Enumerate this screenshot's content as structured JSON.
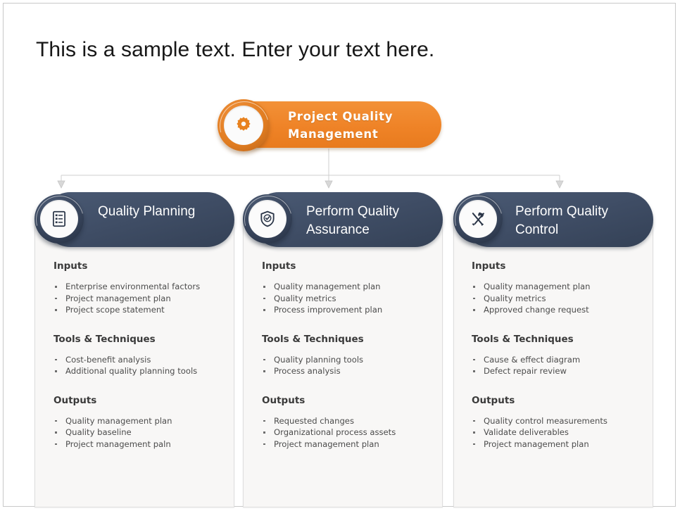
{
  "slide": {
    "title": "This is a sample text. Enter your text here.",
    "accent_orange": "#ef8327",
    "accent_navy": "#3f4d65",
    "card_background": "#f8f7f6"
  },
  "root": {
    "label": "Project Quality Management",
    "icon": "gear-icon"
  },
  "columns": [
    {
      "id": "quality-planning",
      "title": "Quality Planning",
      "icon": "clipboard-list-icon",
      "sections": [
        {
          "heading": "Inputs",
          "items": [
            "Enterprise environmental  factors",
            "Project management  plan",
            "Project scope statement"
          ]
        },
        {
          "heading": "Tools & Techniques",
          "items": [
            "Cost-benefit analysis",
            "Additional quality planning  tools"
          ]
        },
        {
          "heading": "Outputs",
          "items": [
            "Quality management  plan",
            "Quality baseline",
            "Project management  paln"
          ]
        }
      ]
    },
    {
      "id": "perform-quality-assurance",
      "title": "Perform Quality Assurance",
      "icon": "shield-check-icon",
      "sections": [
        {
          "heading": "Inputs",
          "items": [
            "Quality management  plan",
            "Quality metrics",
            "Process improvement  plan"
          ]
        },
        {
          "heading": "Tools & Techniques",
          "items": [
            "Quality planning  tools",
            "Process analysis"
          ]
        },
        {
          "heading": "Outputs",
          "items": [
            "Requested changes",
            "Organizational  process assets",
            "Project management  plan"
          ]
        }
      ]
    },
    {
      "id": "perform-quality-control",
      "title": "Perform Quality Control",
      "icon": "tools-cross-icon",
      "sections": [
        {
          "heading": "Inputs",
          "items": [
            "Quality management  plan",
            "Quality metrics",
            "Approved change request"
          ]
        },
        {
          "heading": "Tools & Techniques",
          "items": [
            "Cause & effect diagram",
            "Defect repair  review"
          ]
        },
        {
          "heading": "Outputs",
          "items": [
            "Quality control measurements",
            "Validate deliverables",
            "Project management  plan"
          ]
        }
      ]
    }
  ]
}
